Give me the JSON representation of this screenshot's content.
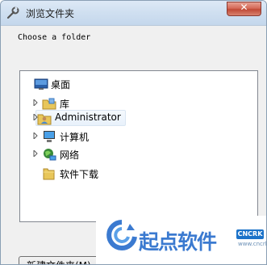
{
  "window": {
    "title": "浏览文件夹",
    "close_glyph": "✕"
  },
  "dialog": {
    "description": "Choose a folder"
  },
  "tree": {
    "items": [
      {
        "label": "桌面",
        "icon": "desktop-icon",
        "expandable": false
      },
      {
        "label": "库",
        "icon": "library-icon",
        "expandable": true
      },
      {
        "label": "Administrator",
        "icon": "user-folder-icon",
        "expandable": true,
        "selected": true
      },
      {
        "label": "计算机",
        "icon": "computer-icon",
        "expandable": true
      },
      {
        "label": "网络",
        "icon": "network-icon",
        "expandable": true
      },
      {
        "label": "软件下载",
        "icon": "folder-icon",
        "expandable": false
      }
    ]
  },
  "buttons": {
    "new_folder": "新建文件夹(M)"
  },
  "watermark": {
    "text": "起点软件",
    "badge": "CNCRK",
    "small": "www.cncrk.com"
  },
  "colors": {
    "title_gradient_top": "#dde9f6",
    "close_red": "#c04a36",
    "watermark_blue": "#3b7ad0"
  }
}
